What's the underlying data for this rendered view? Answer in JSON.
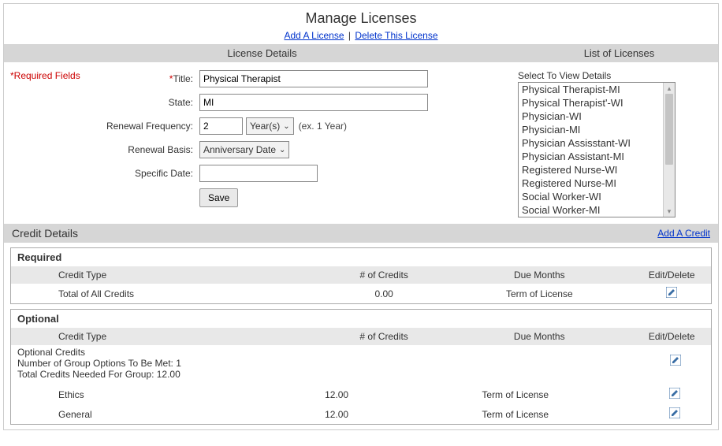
{
  "header": {
    "title": "Manage Licenses",
    "addLink": "Add A License",
    "deleteLink": "Delete This License"
  },
  "sectionBar": {
    "details": "License Details",
    "list": "List of Licenses"
  },
  "required_label": "*Required Fields",
  "form": {
    "title_label": "Title:",
    "title_value": "Physical Therapist",
    "state_label": "State:",
    "state_value": "MI",
    "renewal_freq_label": "Renewal Frequency:",
    "renewal_freq_value": "2",
    "renewal_freq_unit": "Year(s)",
    "renewal_freq_hint": "(ex. 1 Year)",
    "renewal_basis_label": "Renewal Basis:",
    "renewal_basis_value": "Anniversary Date",
    "specific_date_label": "Specific Date:",
    "specific_date_value": "",
    "save_label": "Save"
  },
  "listbox": {
    "label": "Select To View Details",
    "items": [
      "Physical Therapist-MI",
      "Physical Therapist'-WI",
      "Physician-WI",
      "Physician-MI",
      "Physician Assisstant-WI",
      "Physician Assistant-MI",
      "Registered Nurse-WI",
      "Registered Nurse-MI",
      "Social Worker-WI",
      "Social Worker-MI"
    ]
  },
  "credit": {
    "bar_label": "Credit Details",
    "add_link": "Add A Credit",
    "columns": {
      "type": "Credit Type",
      "num": "# of Credits",
      "due": "Due Months",
      "ed": "Edit/Delete"
    },
    "required": {
      "title": "Required",
      "rows": [
        {
          "type": "Total of All Credits",
          "num": "0.00",
          "due": "Term of License"
        }
      ]
    },
    "optional": {
      "title": "Optional",
      "group_header": "Optional Credits",
      "group_line1": "Number of Group Options To Be Met: 1",
      "group_line2": "Total Credits Needed For Group: 12.00",
      "rows": [
        {
          "type": "Ethics",
          "num": "12.00",
          "due": "Term of License"
        },
        {
          "type": "General",
          "num": "12.00",
          "due": "Term of License"
        }
      ]
    }
  }
}
